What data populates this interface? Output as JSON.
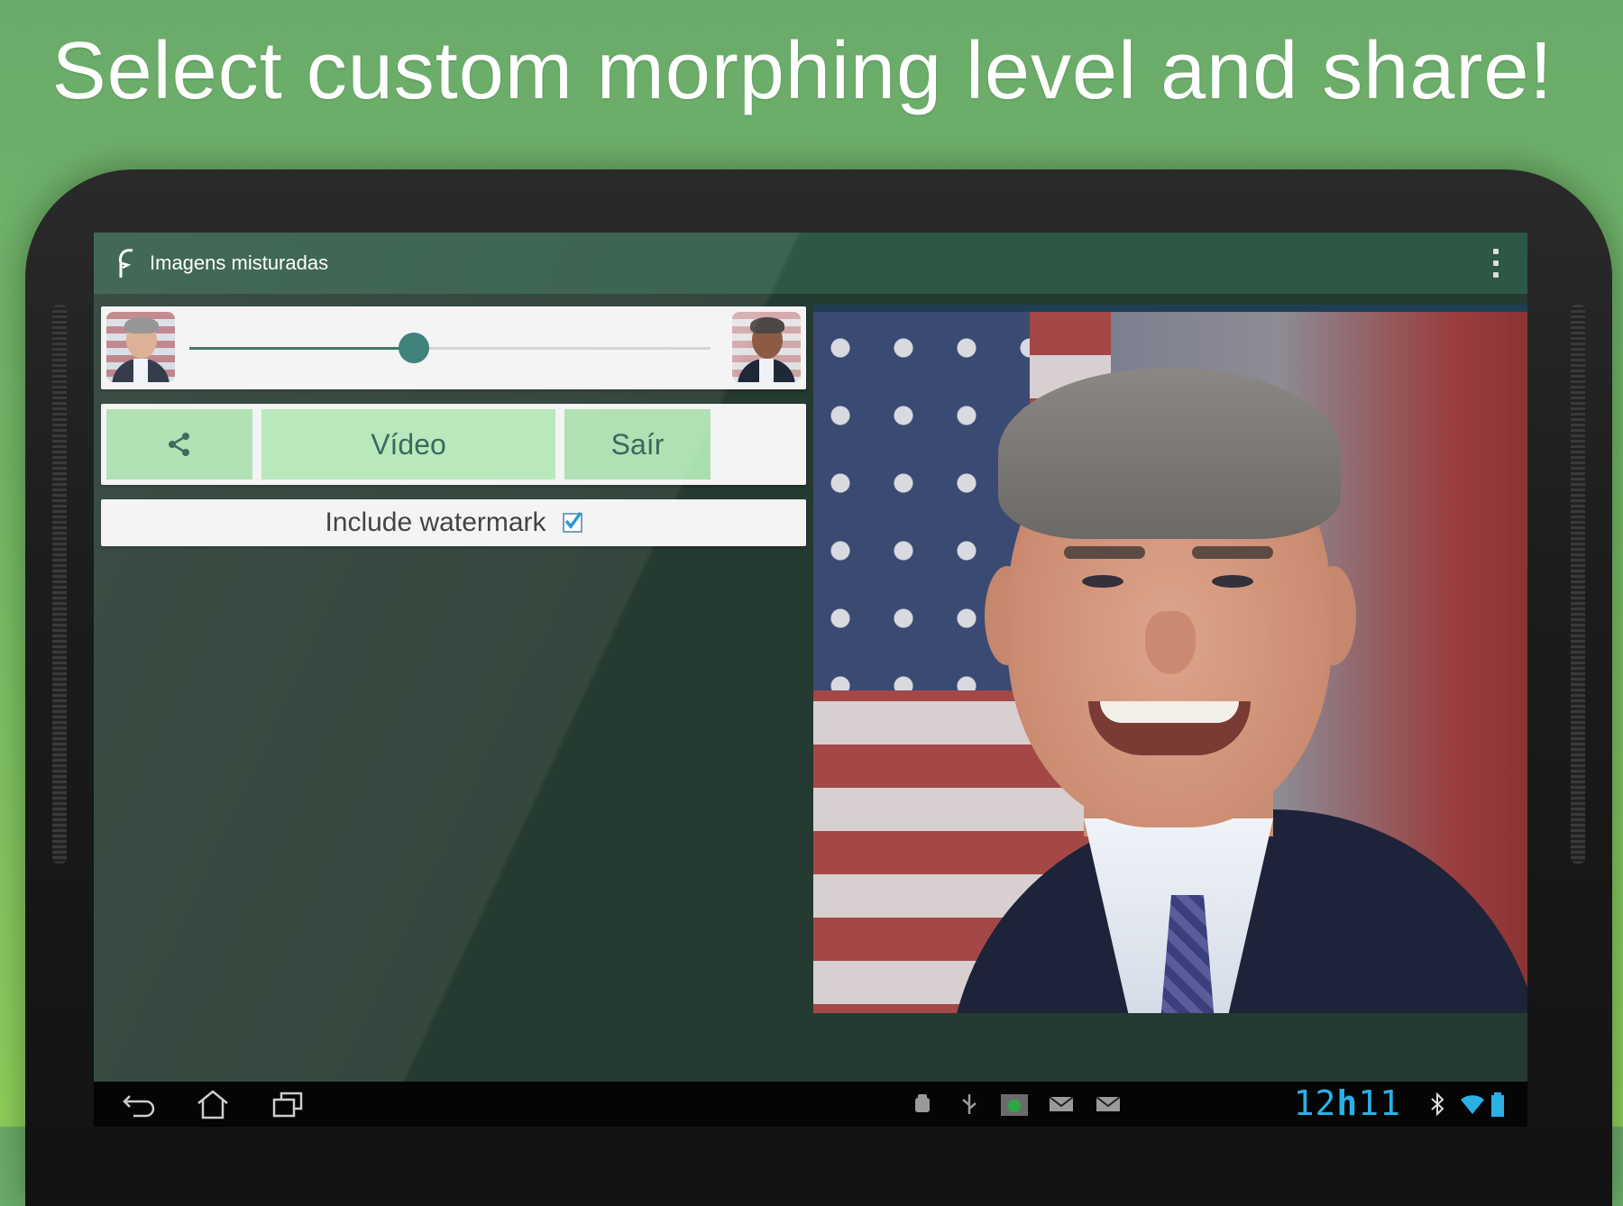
{
  "promo": {
    "title": "Select custom morphing level and share!"
  },
  "action_bar": {
    "title": "Imagens misturadas",
    "app_icon": "face-outline-icon",
    "menu_icon": "overflow-menu-icon"
  },
  "morph_slider": {
    "left_face": "portrait-bush-thumbnail",
    "right_face": "portrait-obama-thumbnail",
    "value_fraction": 0.43
  },
  "buttons": {
    "share_icon": "share-icon",
    "video_label": "Vídeo",
    "exit_label": "Saír"
  },
  "watermark": {
    "label": "Include watermark",
    "checked": true
  },
  "status_bar": {
    "clock_hours": "12",
    "clock_sep": "h",
    "clock_minutes": "11"
  },
  "colors": {
    "accent": "#2e7670",
    "button_bg": "#a9dfae",
    "action_bar": "#2d5845",
    "clock": "#2bb0e6"
  }
}
